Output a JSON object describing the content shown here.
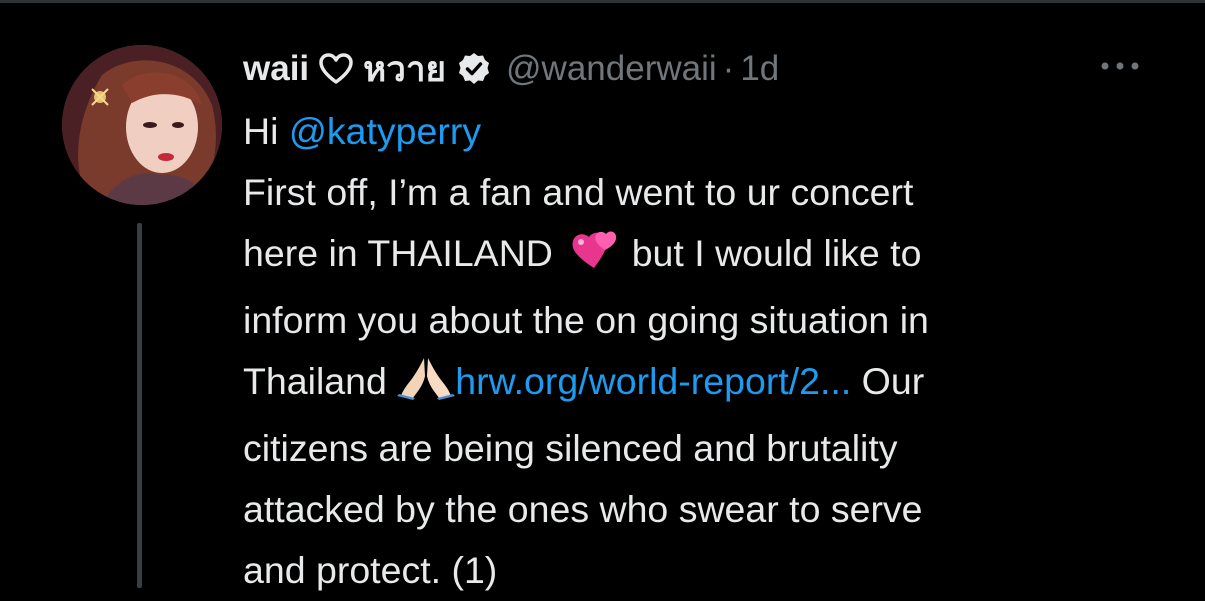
{
  "tweet": {
    "author": {
      "display_name": "waii",
      "thai_name": "หวาย",
      "handle": "@wanderwaii",
      "heart_icon": "heart-outline-icon",
      "verified_icon": "verified-badge-icon"
    },
    "separator": "·",
    "timestamp": "1d",
    "body": {
      "greeting": "Hi ",
      "mention": "@katyperry",
      "line2": "First off, I’m a fan and went to ur concert",
      "line3_a": "here in THAILAND ",
      "line3_b": " but I would like to",
      "line4": "inform you about the on going situation in",
      "line5_a": "Thailand ",
      "link": "hrw.org/world-report/2...",
      "line5_b": " Our",
      "line6": "citizens are being silenced and brutality",
      "line7": "attacked by the ones who swear to serve",
      "line8": "and protect. (1)"
    },
    "emojis": [
      "two-hearts-emoji",
      "folded-hands-emoji"
    ]
  },
  "colors": {
    "background": "#000000",
    "text": "#e7e9ea",
    "secondary": "#71767b",
    "accent": "#1d9bf0",
    "thread_line": "#3a3d41"
  }
}
